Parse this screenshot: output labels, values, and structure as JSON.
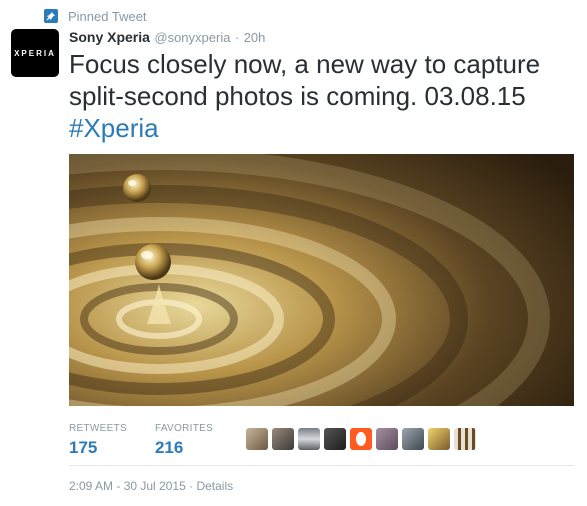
{
  "pinned": {
    "label": "Pinned Tweet",
    "icon": "pin-icon"
  },
  "author": {
    "avatar_text": "XPERIA",
    "name": "Sony Xperia",
    "handle": "@sonyxperia",
    "separator": "·",
    "time": "20h"
  },
  "tweet": {
    "text": "Focus closely now, a new way to capture split-second photos is coming. 03.08.15",
    "hashtag": "#Xperia"
  },
  "stats": {
    "retweets_label": "RETWEETS",
    "retweets_value": "175",
    "favorites_label": "FAVORITES",
    "favorites_value": "216"
  },
  "footer": {
    "timestamp": "2:09 AM - 30 Jul 2015",
    "separator": "·",
    "details_label": "Details"
  },
  "colors": {
    "link": "#2b7bb9",
    "muted": "#8899a6",
    "text": "#292f33"
  }
}
